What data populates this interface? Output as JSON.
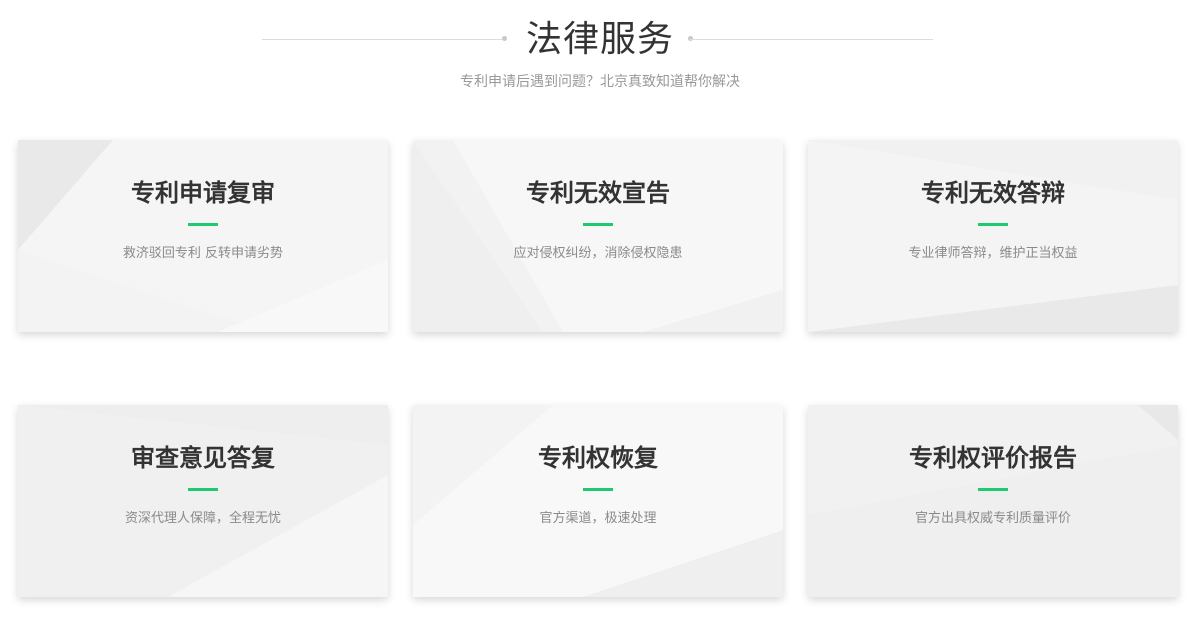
{
  "header": {
    "title": "法律服务",
    "subtitle": "专利申请后遇到问题？北京真致知道帮你解决"
  },
  "colors": {
    "accent": "#1fc96f",
    "card_bg": "#f3f3f3",
    "title_text": "#333333",
    "desc_text": "#8a8a8a"
  },
  "cards": [
    {
      "title": "专利申请复审",
      "desc": "救济驳回专利 反转申请劣势"
    },
    {
      "title": "专利无效宣告",
      "desc": "应对侵权纠纷，消除侵权隐患"
    },
    {
      "title": "专利无效答辩",
      "desc": "专业律师答辩，维护正当权益"
    },
    {
      "title": "审查意见答复",
      "desc": "资深代理人保障，全程无忧"
    },
    {
      "title": "专利权恢复",
      "desc": "官方渠道，极速处理"
    },
    {
      "title": "专利权评价报告",
      "desc": "官方出具权威专利质量评价"
    }
  ]
}
